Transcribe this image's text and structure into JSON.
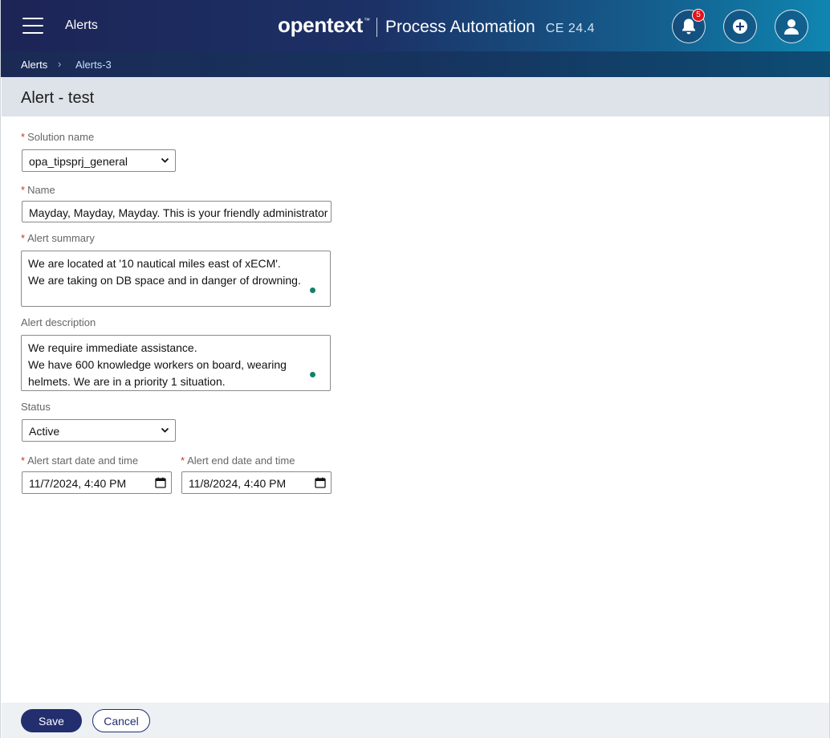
{
  "header": {
    "app_title": "Alerts",
    "brand_logo": "opentext",
    "brand_tm": "™",
    "brand_product": "Process Automation",
    "brand_edition": "CE  24.4",
    "notification_count": "5",
    "icons": [
      "menu-icon",
      "bell-icon",
      "plus-circle-icon",
      "user-icon"
    ]
  },
  "breadcrumb": {
    "root": "Alerts",
    "separator": "›",
    "current": "Alerts-3"
  },
  "page": {
    "title": "Alert - test"
  },
  "form": {
    "required_mark": "*",
    "solution_name": {
      "label": "Solution name",
      "value": "opa_tipsprj_general"
    },
    "name": {
      "label": "Name",
      "value": "Mayday, Mayday, Mayday. This is your friendly administrator"
    },
    "alert_summary": {
      "label": "Alert summary",
      "line1": "We are located at '10 nautical miles east of xECM'.",
      "line2": "We are taking on DB space and in danger of drowning."
    },
    "alert_description": {
      "label": "Alert description",
      "line1": "We require immediate assistance.",
      "line2": "We have 600 knowledge workers on board, wearing",
      "line3": "helmets. We are in a priority 1 situation."
    },
    "status": {
      "label": "Status",
      "value": "Active"
    },
    "start": {
      "label": "Alert start date and time",
      "value": "11/7/2024, 4:40 PM"
    },
    "end": {
      "label": "Alert end date and time",
      "value": "11/8/2024, 4:40 PM"
    }
  },
  "footer": {
    "save_label": "Save",
    "cancel_label": "Cancel"
  },
  "colors": {
    "header_start": "#1d2456",
    "header_end": "#0f86b1",
    "primary_button": "#232e6f",
    "required": "#c8352b",
    "badge": "#e3131a",
    "grammar_dot": "#12806d"
  }
}
